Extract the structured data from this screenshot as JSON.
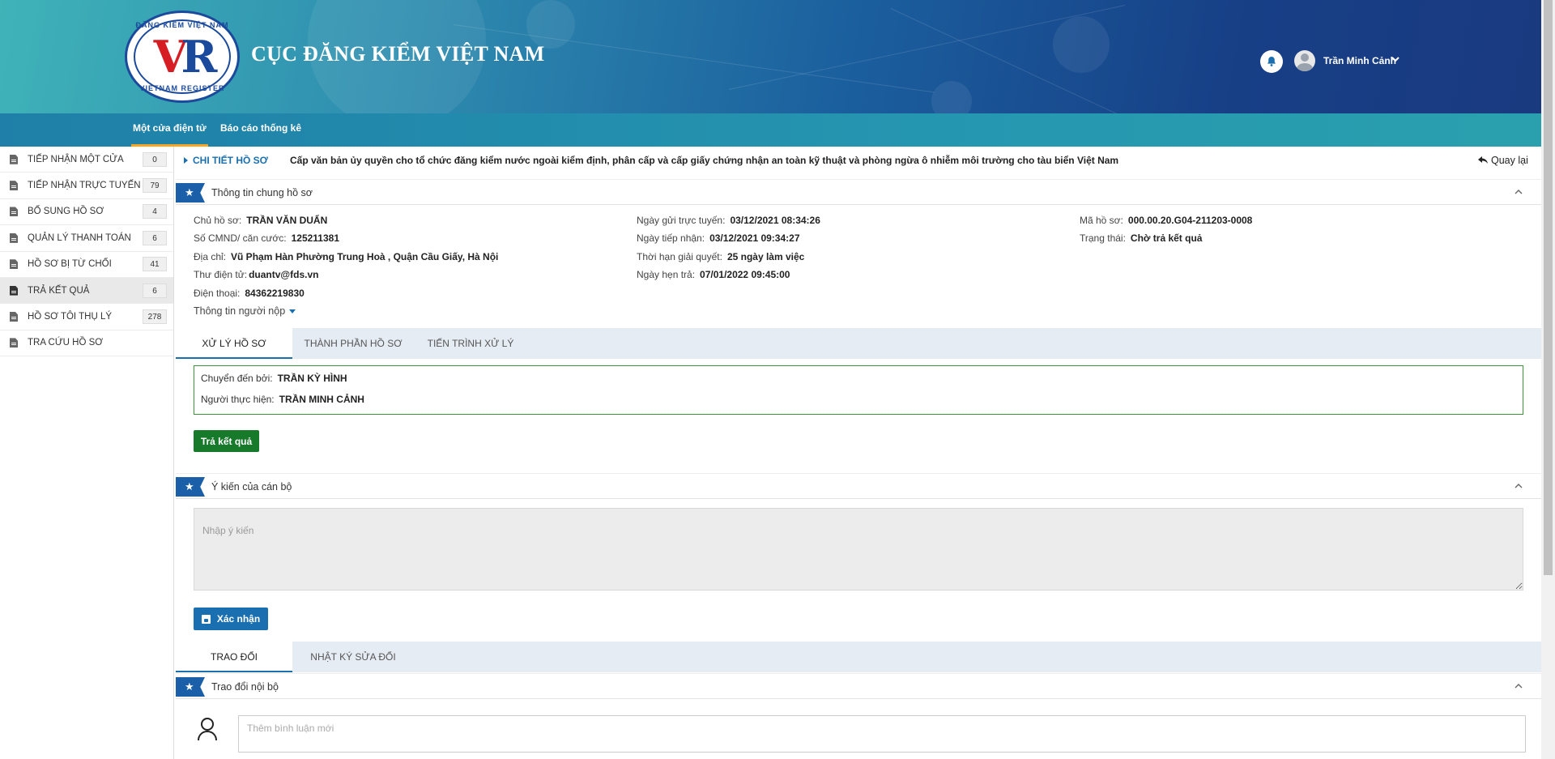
{
  "header": {
    "logo_top_text": "ĐĂNG KIỂM VIỆT NAM",
    "logo_bottom_text": "VIETNAM REGISTER",
    "logo_mark_v": "V",
    "logo_mark_r": "R",
    "site_title": "CỤC ĐĂNG KIỂM VIỆT NAM",
    "user_name": "Trần Minh Cảnh"
  },
  "topnav": {
    "items": [
      {
        "label": "Một cửa điện tử",
        "active": true
      },
      {
        "label": "Báo cáo thống kê",
        "active": false
      }
    ]
  },
  "sidebar": {
    "items": [
      {
        "label": "TIẾP NHẬN MỘT CỬA",
        "count": "0"
      },
      {
        "label": "TIẾP NHẬN TRỰC TUYẾN",
        "count": "79"
      },
      {
        "label": "BỔ SUNG HỒ SƠ",
        "count": "4"
      },
      {
        "label": "QUẢN LÝ THANH TOÁN",
        "count": "6"
      },
      {
        "label": "HỒ SƠ BỊ TỪ CHỐI",
        "count": "41"
      },
      {
        "label": "TRẢ KẾT QUẢ",
        "count": "6",
        "active": true
      },
      {
        "label": "HỒ SƠ TÔI THỤ LÝ",
        "count": "278"
      },
      {
        "label": "TRA CỨU HỒ SƠ",
        "count": ""
      }
    ]
  },
  "detail": {
    "label": "CHI TIẾT HỒ SƠ",
    "title": "Cấp văn bản ủy quyền cho tổ chức đăng kiểm nước ngoài kiểm định, phân cấp và cấp giấy chứng nhận an toàn kỹ thuật và phòng ngừa ô nhiễm môi trường cho tàu biển Việt Nam",
    "back_label": "Quay lại"
  },
  "general_info": {
    "section_title": "Thông tin chung hồ sơ",
    "owner_label": "Chủ hồ sơ:",
    "owner_value": "TRẦN VĂN DUẨN",
    "id_label": "Số CMND/ căn cước:",
    "id_value": "125211381",
    "address_label": "Địa chỉ:",
    "address_value": "Vũ Phạm Hàn Phường Trung Hoà , Quận Cầu Giấy, Hà Nội",
    "email_label": "Thư điện tử:",
    "email_value": "duantv@fds.vn",
    "phone_label": "Điện thoại:",
    "phone_value": "84362219830",
    "sent_label": "Ngày gửi trực tuyến:",
    "sent_value": "03/12/2021 08:34:26",
    "received_label": "Ngày tiếp nhận:",
    "received_value": "03/12/2021 09:34:27",
    "deadline_label": "Thời hạn giải quyết:",
    "deadline_value": "25 ngày làm việc",
    "return_label": "Ngày hẹn trả:",
    "return_value": "07/01/2022 09:45:00",
    "code_label": "Mã hồ sơ:",
    "code_value": "000.00.20.G04-211203-0008",
    "status_label": "Trạng thái:",
    "status_value": "Chờ trả kết quả",
    "submitter_toggle": "Thông tin người nộp"
  },
  "tabs1": [
    {
      "label": "XỬ LÝ HỒ SƠ",
      "active": true
    },
    {
      "label": "THÀNH PHẦN HỒ SƠ",
      "active": false
    },
    {
      "label": "TIẾN TRÌNH XỬ LÝ",
      "active": false
    }
  ],
  "processing": {
    "from_label": "Chuyển đến bởi:",
    "from_value": "TRẦN KỲ HÌNH",
    "handler_label": "Người thực hiện:",
    "handler_value": "TRẦN MINH CẢNH",
    "return_button": "Trả kết quả"
  },
  "opinion": {
    "section_title": "Ý kiến của cán bộ",
    "placeholder": "Nhập ý kiến",
    "confirm_button": "Xác nhận"
  },
  "tabs2": [
    {
      "label": "TRAO ĐỔI",
      "active": true
    },
    {
      "label": "NHẬT KÝ SỬA ĐỔI",
      "active": false
    }
  ],
  "exchange": {
    "section_title": "Trao đổi nội bộ",
    "comment_placeholder": "Thêm bình luận mới"
  },
  "colors": {
    "primary": "#1a6fb0",
    "success": "#167a2a",
    "accent": "#f5a623"
  }
}
